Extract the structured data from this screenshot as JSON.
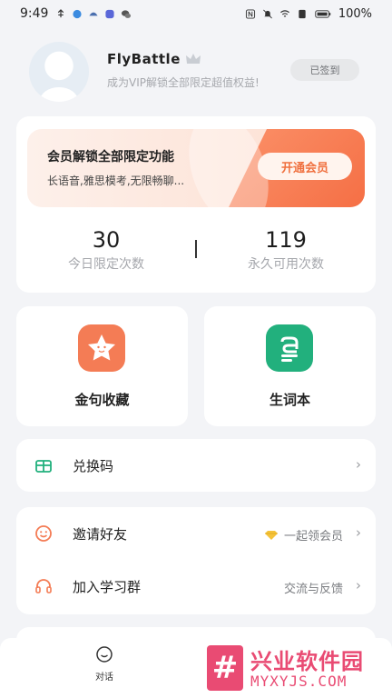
{
  "status_bar": {
    "time": "9:49",
    "battery": "100%"
  },
  "profile": {
    "username": "FlyBattle",
    "subtitle": "成为VIP解锁全部限定超值权益!",
    "checkin_label": "已签到"
  },
  "vip_card": {
    "title": "会员解锁全部限定功能",
    "description": "长语音,雅思模考,无限畅聊...",
    "button_label": "开通会员",
    "stats": [
      {
        "value": "30",
        "label": "今日限定次数"
      },
      {
        "value": "119",
        "label": "永久可用次数"
      }
    ]
  },
  "tiles": [
    {
      "label": "金句收藏",
      "icon": "star-face-icon",
      "color": "#f47c55"
    },
    {
      "label": "生词本",
      "icon": "notebook-a-icon",
      "color": "#22b07d"
    }
  ],
  "rows": {
    "redeem": {
      "label": "兑换码",
      "icon": "gift-box-icon"
    },
    "invite": {
      "label": "邀请好友",
      "value": "一起领会员",
      "icon": "smiley-icon"
    },
    "group": {
      "label": "加入学习群",
      "value": "交流与反馈",
      "icon": "headset-icon"
    }
  },
  "bottom_nav": {
    "items": [
      {
        "label": "对话",
        "icon": "chat-face-icon"
      }
    ]
  },
  "watermark": {
    "title": "兴业软件园",
    "url": "MYXYJS.COM"
  },
  "colors": {
    "accent": "#f0703f",
    "green": "#22b07d",
    "background": "#f3f4f7"
  }
}
